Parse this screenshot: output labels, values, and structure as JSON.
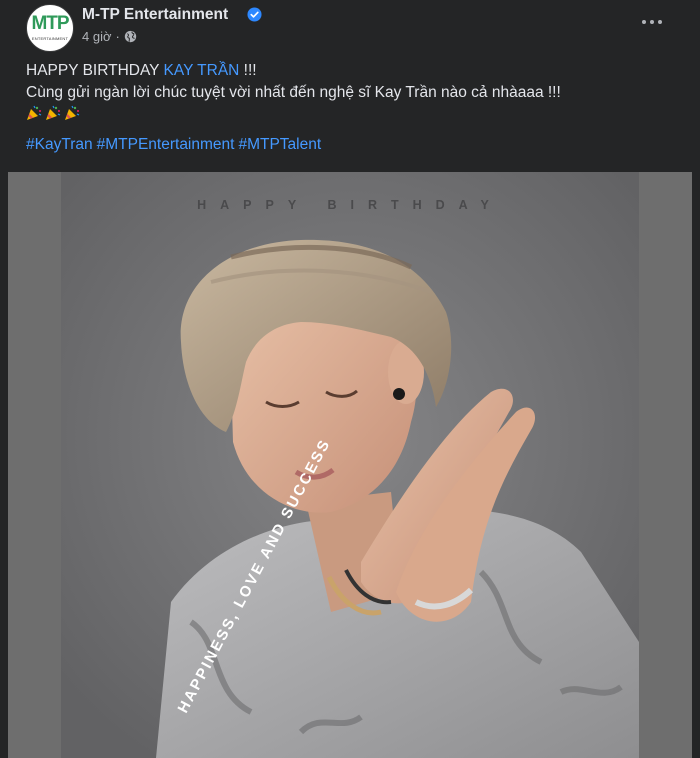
{
  "post": {
    "page_name": "M-TP Entertainment",
    "avatar": {
      "logo_text": "MTP",
      "sub_text": "ENTERTAINMENT"
    },
    "time": "4 giờ",
    "time_separator": "·",
    "privacy_icon": "globe-icon",
    "verified_icon": "verified-badge-icon",
    "more_icon": "more-options-icon",
    "line1_prefix": "HAPPY BIRTHDAY ",
    "mention": "KAY TRẦN",
    "line1_suffix": "  !!!",
    "line2": "Cùng gửi ngàn lời chúc tuyệt vời nhất đến nghệ sĩ Kay Trần nào cả nhàaaa !!!",
    "emoji": [
      "party-popper",
      "party-popper",
      "party-popper"
    ],
    "hashtags": [
      "#KayTran",
      "#MTPEntertainment",
      "#MTPTalent"
    ]
  },
  "image": {
    "headline": "HAPPY BIRTHDAY",
    "slogan": "HAPPINESS, LOVE AND SUCCESS"
  },
  "colors": {
    "background": "#242526",
    "text": "#e4e6eb",
    "secondary": "#b0b3b8",
    "link": "#4599ff",
    "verified": "#2d88ff"
  }
}
